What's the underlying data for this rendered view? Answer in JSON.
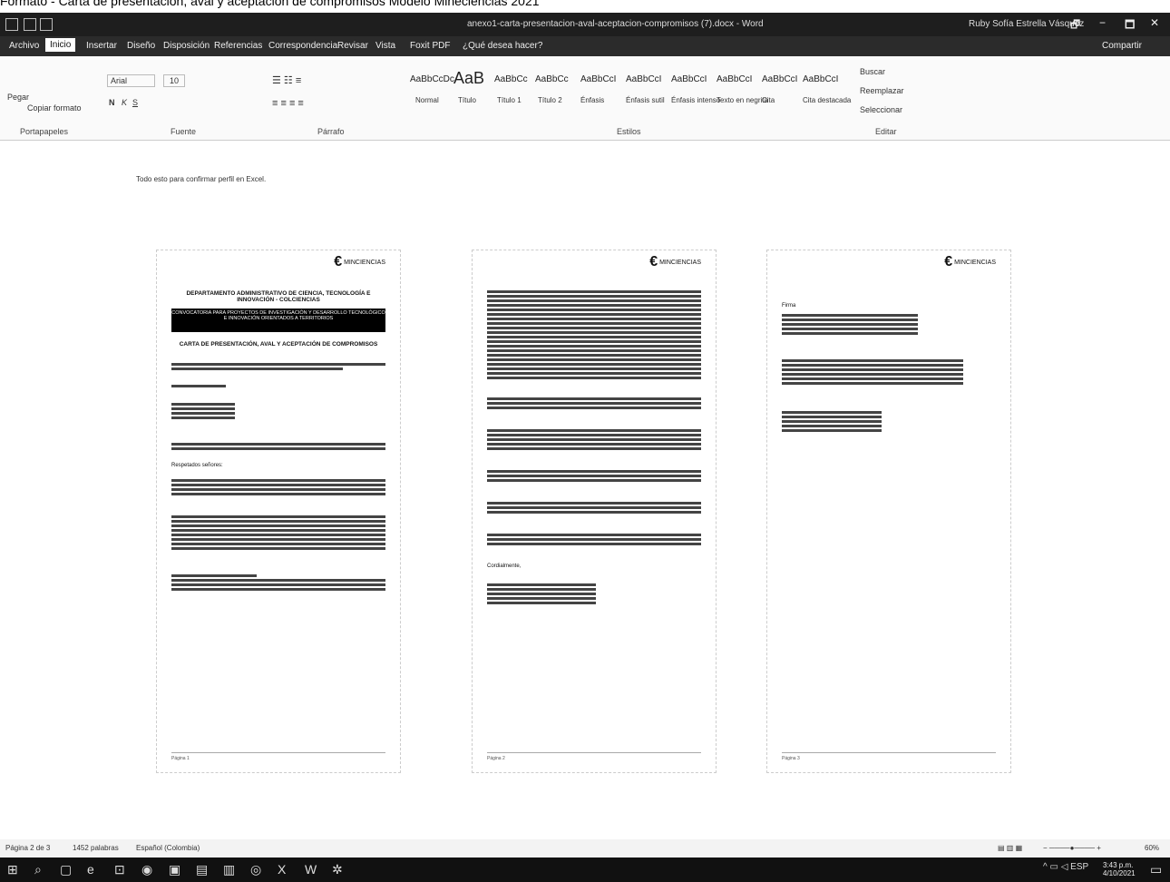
{
  "top_caption": "Formato - Carta de presentación, aval y aceptación de compromisos Modelo Mineciencias 2021",
  "window": {
    "title": "anexo1-carta-presentacion-aval-aceptacion-compromisos (7).docx - Word",
    "user": "Ruby Sofía Estrella Vásquez",
    "controls": [
      "🗗",
      "−",
      "🗖",
      "✕"
    ]
  },
  "menu": {
    "items": [
      "Archivo",
      "Inicio",
      "Insertar",
      "Diseño",
      "Disposición",
      "Referencias",
      "Correspondencia",
      "Revisar",
      "Vista",
      "Foxit PDF",
      "¿Qué desea hacer?"
    ],
    "share": "Compartir"
  },
  "ribbon": {
    "clipboard": {
      "paste": "Pegar",
      "copy_format": "Copiar formato",
      "group": "Portapapeles"
    },
    "font": {
      "name": "Arial",
      "size": "10",
      "group": "Fuente"
    },
    "paragraph": {
      "group": "Párrafo"
    },
    "styles": {
      "group": "Estilos",
      "items": [
        {
          "preview": "AaBbCcDc",
          "name": "Normal"
        },
        {
          "preview": "AaB",
          "name": "Título"
        },
        {
          "preview": "AaBbCc",
          "name": "Título 1"
        },
        {
          "preview": "AaBbCc",
          "name": "Título 2"
        },
        {
          "preview": "AaBbCcI",
          "name": "Énfasis"
        },
        {
          "preview": "AaBbCcI",
          "name": "Énfasis sutil"
        },
        {
          "preview": "AaBbCcI",
          "name": "Énfasis intenso"
        },
        {
          "preview": "AaBbCcI",
          "name": "Texto en negrita"
        },
        {
          "preview": "AaBbCcI",
          "name": "Cita"
        },
        {
          "preview": "AaBbCcI",
          "name": "Cita destacada"
        }
      ]
    },
    "editing": {
      "find": "Buscar",
      "replace": "Reemplazar",
      "select": "Seleccionar",
      "group": "Editar"
    }
  },
  "document": {
    "note": "Todo esto para confirmar perfil en Excel.",
    "page1": {
      "logo": "MINCIENCIAS",
      "heading": "DEPARTAMENTO ADMINISTRATIVO DE CIENCIA, TECNOLOGÍA E INNOVACIÓN - COLCIENCIAS",
      "blackbox": "CONVOCATORIA PARA PROYECTOS DE INVESTIGACIÓN Y DESARROLLO TECNOLÓGICO E INNOVACIÓN ORIENTADOS A TERRITORIOS",
      "subheading": "CARTA DE PRESENTACIÓN, AVAL Y ACEPTACIÓN DE COMPROMISOS",
      "salutation": "Respetados señores:",
      "footer": "Página 1"
    },
    "page2": {
      "logo": "MINCIENCIAS",
      "closing": "Cordialmente,",
      "footer": "Página 2"
    },
    "page3": {
      "logo": "MINCIENCIAS",
      "firma": "Firma",
      "footer": "Página 3"
    }
  },
  "status": {
    "page": "Página 2 de 3",
    "words": "1452 palabras",
    "lang": "Español (Colombia)",
    "zoom": "60%"
  },
  "taskbar": {
    "time": "3:43 p.m.",
    "date": "4/10/2021"
  }
}
